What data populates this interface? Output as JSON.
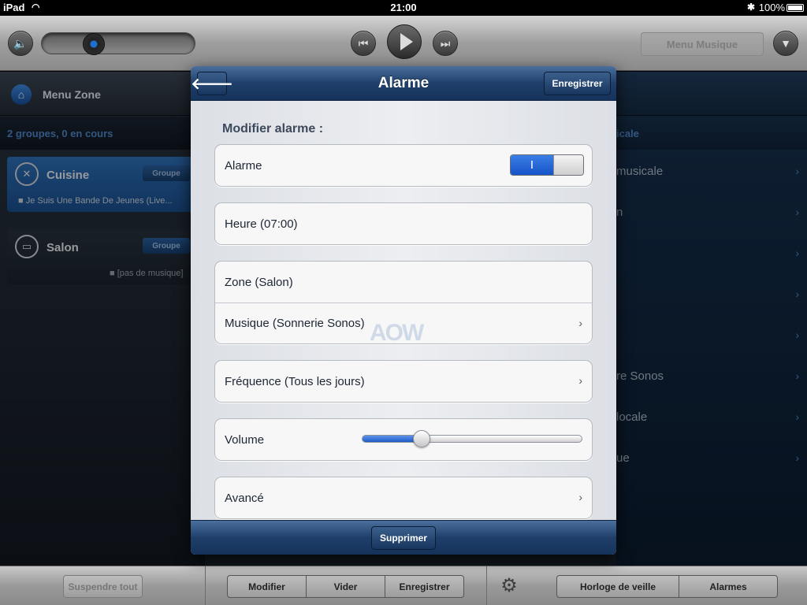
{
  "status_bar": {
    "device": "iPad",
    "time": "21:00",
    "battery": "100%"
  },
  "transport": {
    "menu_button": "Menu Musique"
  },
  "zones_panel": {
    "title": "Menu Zone",
    "summary": "2 groupes, 0 en cours",
    "zones": [
      {
        "name": "Cuisine",
        "group_label": "Groupe",
        "now_playing": "■ Je Suis Une Bande De Jeunes (Live..."
      },
      {
        "name": "Salon",
        "group_label": "Groupe",
        "now_playing": "■ [pas de musique]"
      }
    ]
  },
  "music_panel": {
    "subtitle": "icale",
    "rows": [
      "musicale",
      "n",
      "",
      "",
      "",
      "re Sonos",
      "locale",
      "ue"
    ]
  },
  "bottom_bar": {
    "suspend_all": "Suspendre tout",
    "modify": "Modifier",
    "clear": "Vider",
    "save": "Enregistrer",
    "sleep_timer": "Horloge de veille",
    "alarms": "Alarmes"
  },
  "modal": {
    "title": "Alarme",
    "save_button": "Enregistrer",
    "section_title": "Modifier alarme :",
    "alarm_label": "Alarme",
    "alarm_toggle_text": "I",
    "alarm_enabled": true,
    "time_label": "Heure (07:00)",
    "zone_label": "Zone (Salon)",
    "music_label": "Musique (Sonnerie Sonos)",
    "frequency_label": "Fréquence (Tous les jours)",
    "volume_label": "Volume",
    "volume_level": 0.27,
    "advanced_label": "Avancé",
    "delete_button": "Supprimer",
    "watermark": "AOW"
  },
  "colors": {
    "accent": "#1f5bc8",
    "header": "#1f3f6a",
    "zone_active": "#2d6fb8"
  }
}
